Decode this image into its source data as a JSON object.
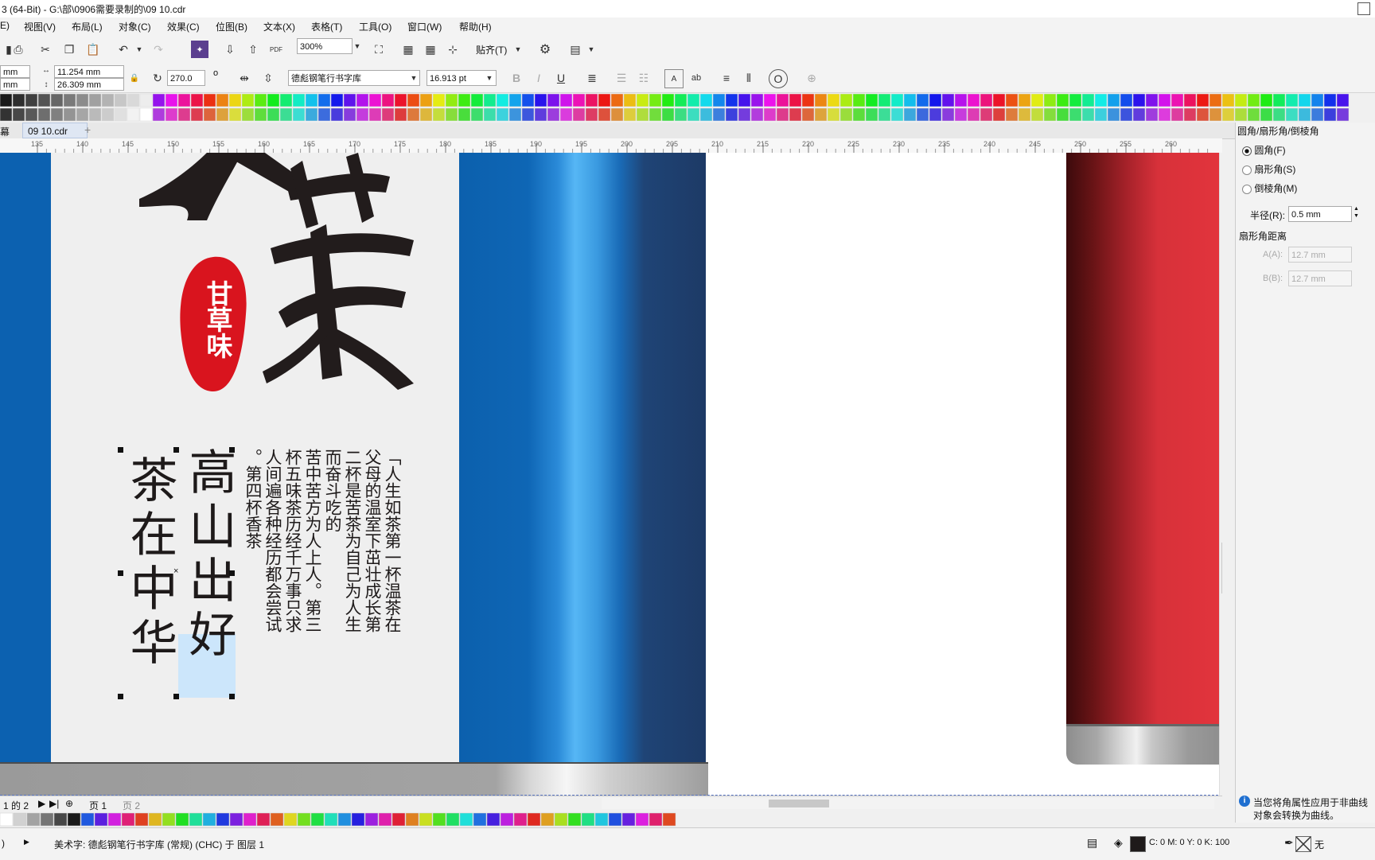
{
  "window": {
    "title": "3 (64-Bit) - G:\\部\\0906需要录制的\\09 10.cdr"
  },
  "menu": [
    "E)",
    "视图(V)",
    "布局(L)",
    "对象(C)",
    "效果(C)",
    "位图(B)",
    "文本(X)",
    "表格(T)",
    "工具(O)",
    "窗口(W)",
    "帮助(H)"
  ],
  "toolbar": {
    "zoom": "300%",
    "snap_label": "贴齐(T)",
    "pdf_label": "PDF"
  },
  "property_bar": {
    "pos_x": "mm",
    "pos_y": "mm",
    "width": "11.254 mm",
    "height": "26.309 mm",
    "rotation": "270.0",
    "degree": "o",
    "font_name": "德彪钢笔行书字库",
    "font_size": "16.913 pt",
    "bold": "B",
    "italic": "I",
    "underline": "U",
    "ab_label": "ab"
  },
  "doc_tabs": {
    "first": "幕",
    "active": "09 10.cdr",
    "add": "+"
  },
  "ruler": {
    "ticks": [
      "135",
      "140",
      "145",
      "150",
      "155",
      "160",
      "165",
      "170",
      "175",
      "180",
      "185",
      "190",
      "195",
      "200",
      "205",
      "210",
      "215",
      "220",
      "225",
      "230",
      "235",
      "240",
      "245",
      "250",
      "255",
      "260"
    ]
  },
  "artwork": {
    "seal_text": "甘草味",
    "slogan_col1": "茶在中华",
    "slogan_col2": "高山出好",
    "poem_cols": [
      "「人生如茶第一杯温茶在",
      "父母的温室下茁壮成长第",
      "二杯是苦茶为自己为人生",
      "而奋斗吃的",
      "苦中苦方为人上人。第三",
      "杯五味茶历经千万事只求",
      "人间遍各种经历都会尝试",
      "。第四杯香茶"
    ]
  },
  "right_panel": {
    "title": "圆角/扇形角/倒棱角",
    "options": [
      "圆角(F)",
      "扇形角(S)",
      "倒棱角(M)"
    ],
    "selected": 0,
    "radius_label": "半径(R):",
    "radius_value": "0.5 mm",
    "distance_label": "扇形角距离",
    "a_label": "A(A):",
    "a_value": "12.7 mm",
    "b_label": "B(B):",
    "b_value": "12.7 mm",
    "info_line1": "当您将角属性应用于非曲线",
    "info_line2": "对象会转换为曲线。"
  },
  "page_nav": {
    "of": "1 的 2",
    "page1": "页 1",
    "page2": "页 2"
  },
  "status": {
    "left": ")",
    "description": "美术字: 德彪钢笔行书字库 (常规) (CHC) 于 图层 1",
    "fill": "C: 0 M: 0 Y: 0 K: 100",
    "outline": "无"
  },
  "colors": {
    "blue_panel": "#0d5fad",
    "dark_blue": "#1c3b66",
    "red_can": "#e0323a",
    "seal_red": "#d9141e",
    "ink": "#1e1a1a"
  }
}
